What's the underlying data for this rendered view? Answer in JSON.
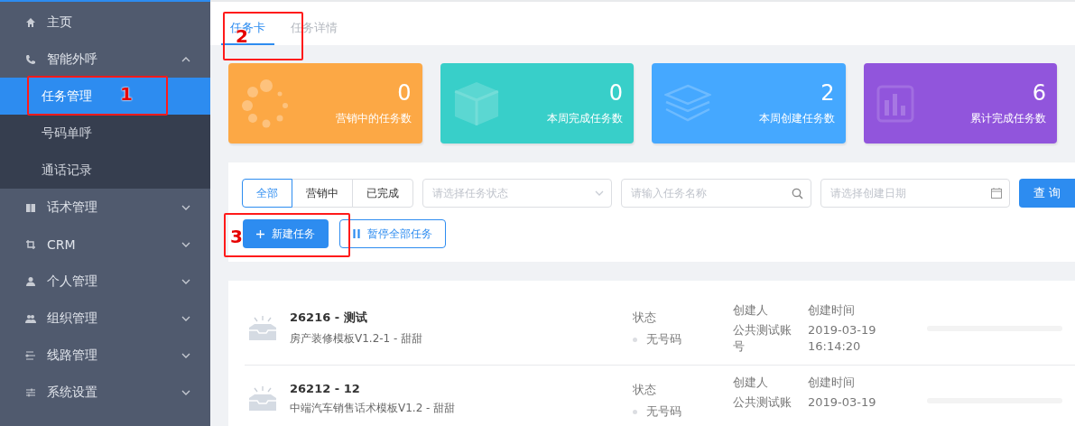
{
  "sidebar": {
    "items": [
      {
        "label": "主页"
      },
      {
        "label": "智能外呼",
        "expanded": true,
        "children": [
          {
            "label": "任务管理",
            "selected": true
          },
          {
            "label": "号码单呼",
            "selected": false
          },
          {
            "label": "通话记录",
            "selected": false
          }
        ]
      },
      {
        "label": "话术管理",
        "expanded": false
      },
      {
        "label": "CRM",
        "expanded": false
      },
      {
        "label": "个人管理",
        "expanded": false
      },
      {
        "label": "组织管理",
        "expanded": false
      },
      {
        "label": "线路管理",
        "expanded": false
      },
      {
        "label": "系统设置",
        "expanded": false
      }
    ]
  },
  "tabs": [
    {
      "label": "任务卡",
      "selected": true
    },
    {
      "label": "任务详情",
      "selected": false
    }
  ],
  "stats": [
    {
      "value": "0",
      "label": "营销中的任务数",
      "color": "#fca845"
    },
    {
      "value": "0",
      "label": "本周完成任务数",
      "color": "#38cfc9"
    },
    {
      "value": "2",
      "label": "本周创建任务数",
      "color": "#45a8ff"
    },
    {
      "value": "6",
      "label": "累计完成任务数",
      "color": "#9155dc"
    }
  ],
  "filters": {
    "segments": [
      {
        "label": "全部",
        "selected": true
      },
      {
        "label": "营销中",
        "selected": false
      },
      {
        "label": "已完成",
        "selected": false
      }
    ],
    "status_select": {
      "placeholder": "请选择任务状态"
    },
    "name_search": {
      "placeholder": "请输入任务名称"
    },
    "date_picker": {
      "placeholder": "请选择创建日期"
    },
    "query_button": "查 询"
  },
  "actions": {
    "new_task": "新建任务",
    "pause_all": "暂停全部任务"
  },
  "tasks": [
    {
      "title": "26216 - 测试",
      "subtitle": "房产装修模板V1.2-1 - 甜甜",
      "status_label": "状态",
      "status": "无号码",
      "creator_label": "创建人",
      "creator": "公共测试账号",
      "time_label": "创建时间",
      "time": "2019-03-19 16:14:20",
      "progress": {
        "level": 0
      }
    },
    {
      "title": "26212 - 12",
      "subtitle": "中端汽车销售话术模板V1.2 - 甜甜",
      "status_label": "状态",
      "status": "无号码",
      "creator_label": "创建人",
      "creator": "公共测试账",
      "time_label": "创建时间",
      "time": "2019-03-19",
      "progress": {
        "level": 0
      }
    }
  ],
  "annotations": [
    "1",
    "2",
    "3"
  ]
}
